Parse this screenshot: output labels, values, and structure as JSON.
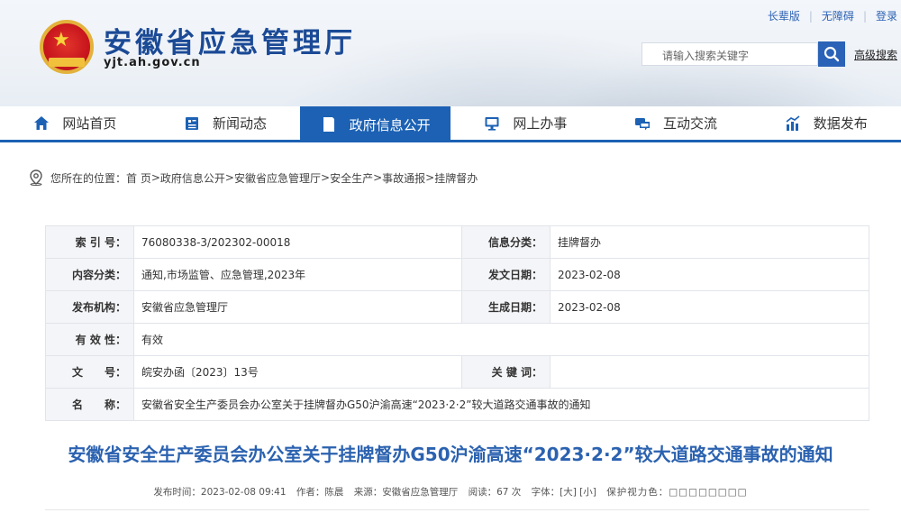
{
  "header": {
    "site_title": "安徽省应急管理厅",
    "site_domain": "yjt.ah.gov.cn",
    "top_links": [
      "长辈版",
      "无障碍",
      "登录"
    ],
    "search_placeholder": "请输入搜索关键字",
    "advanced_search": "高级搜索"
  },
  "nav": {
    "items": [
      {
        "label": "网站首页",
        "icon": "home-icon"
      },
      {
        "label": "新闻动态",
        "icon": "news-icon"
      },
      {
        "label": "政府信息公开",
        "icon": "document-icon",
        "active": true
      },
      {
        "label": "网上办事",
        "icon": "monitor-icon"
      },
      {
        "label": "互动交流",
        "icon": "chat-icon"
      },
      {
        "label": "数据发布",
        "icon": "chart-icon"
      }
    ],
    "accent_color": "#1c61b4"
  },
  "breadcrumb": {
    "prefix": "您所在的位置：",
    "items": [
      "首 页",
      "政府信息公开",
      "安徽省应急管理厅",
      "安全生产",
      "事故通报",
      "挂牌督办"
    ],
    "separator": " > "
  },
  "info": {
    "index_label": "索 引 号：",
    "index_value": "76080338-3/202302-00018",
    "category_label": "信息分类：",
    "category_value": "挂牌督办",
    "content_label": "内容分类：",
    "content_value": "通知,市场监管、应急管理,2023年",
    "issue_date_label": "发文日期：",
    "issue_date_value": "2023-02-08",
    "publisher_label": "发布机构：",
    "publisher_value": "安徽省应急管理厅",
    "effective_date_label": "生成日期：",
    "effective_date_value": "2023-02-08",
    "validity_label": "有 效 性：",
    "validity_value": "有效",
    "doc_no_label": "文　　号：",
    "doc_no_value": "皖安办函〔2023〕13号",
    "keywords_label": "关 键 词：",
    "keywords_value": "",
    "name_label": "名　　称：",
    "name_value": "安徽省安全生产委员会办公室关于挂牌督办G50沪渝高速“2023·2·2”较大道路交通事故的通知"
  },
  "article": {
    "title": "安徽省安全生产委员会办公室关于挂牌督办G50沪渝高速“2023·2·2”较大道路交通事故的通知",
    "publish_time": "发布时间：2023-02-08 09:41",
    "author": "作者：陈晨",
    "source": "来源：安徽省应急管理厅",
    "views": "阅读：67 次",
    "font_size": "字体：[大] [小]",
    "eye_protection": "保护视力色：□□□□□□□□"
  }
}
